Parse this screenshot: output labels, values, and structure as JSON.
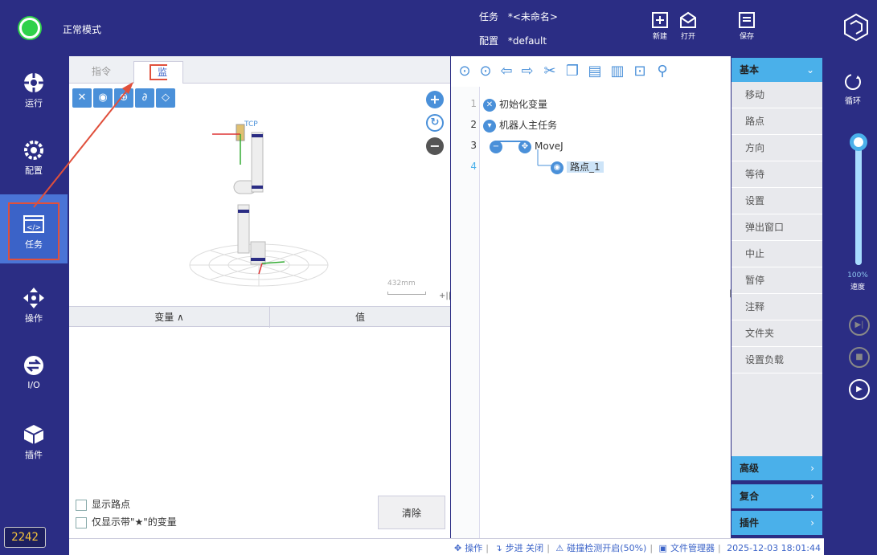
{
  "topbar": {
    "mode_label": "正常模式",
    "task_key": "任务",
    "task_value": "*<未命名>",
    "config_key": "配置",
    "config_value": "*default",
    "new_label": "新建",
    "open_label": "打开",
    "save_label": "保存"
  },
  "leftnav": {
    "items": [
      {
        "label": "运行",
        "icon": "run-icon"
      },
      {
        "label": "配置",
        "icon": "config-icon"
      },
      {
        "label": "任务",
        "icon": "task-code-icon"
      },
      {
        "label": "操作",
        "icon": "move-arrows-icon"
      },
      {
        "label": "I/O",
        "icon": "io-icon"
      },
      {
        "label": "插件",
        "icon": "plugin-cube-icon"
      }
    ],
    "active": "任务",
    "counter": "2242"
  },
  "leftpanel": {
    "tabs": [
      "指令",
      "监控"
    ],
    "active_tab": "监控",
    "view3d": {
      "tcp_label": "TCP",
      "scale_label": "432mm"
    },
    "table": {
      "col_variable": "变量 ∧",
      "col_value": "值"
    },
    "show_waypoints": "显示路点",
    "show_starred": "仅显示带\"★\"的变量",
    "clear_label": "清除"
  },
  "program": {
    "lines": [
      {
        "no": "1",
        "text": "初始化变量"
      },
      {
        "no": "2",
        "text": "机器人主任务"
      },
      {
        "no": "3",
        "text": "MoveJ"
      },
      {
        "no": "4",
        "text": "路点_1"
      }
    ]
  },
  "rightpanel": {
    "basic_label": "基本",
    "items": [
      "移动",
      "路点",
      "方向",
      "等待",
      "设置",
      "弹出窗口",
      "中止",
      "暂停",
      "注释",
      "文件夹",
      "设置负载"
    ],
    "advanced_label": "高级",
    "composite_label": "复合",
    "plugin_label": "插件"
  },
  "farright": {
    "loop_label": "循环",
    "speed_pct": "100%",
    "speed_value": 1.0,
    "speed_label": "速度"
  },
  "statusbar": {
    "op": "操作",
    "step": "步进 关闭",
    "collision": "碰撞检测开启(50%)",
    "filemgr": "文件管理器",
    "datetime": "2025-12-03 18:01:44"
  },
  "colors": {
    "navy": "#2b2d84",
    "accent_blue": "#4a90d9",
    "highlight_red": "#e0503c",
    "mode_green": "#2fd14a"
  }
}
